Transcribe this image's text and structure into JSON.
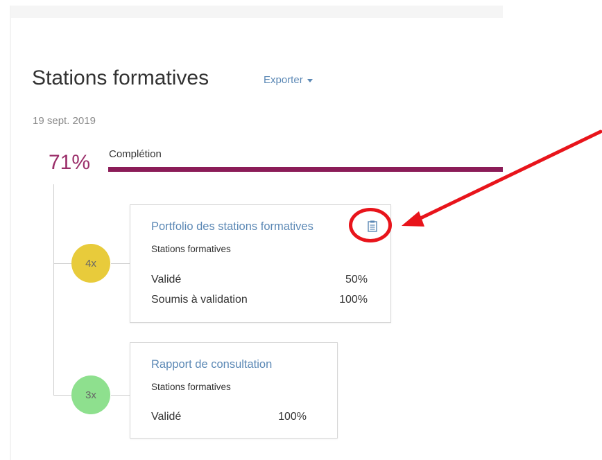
{
  "page": {
    "title": "Stations formatives",
    "export_label": "Exporter",
    "date": "19 sept. 2019"
  },
  "completion": {
    "percent_label": "71%",
    "label": "Complétion",
    "value": 0.71
  },
  "items": [
    {
      "badge": "4x",
      "badge_color": "#e8cb3b",
      "title": "Portfolio des stations formatives",
      "subtitle": "Stations formatives",
      "has_icon": true,
      "icon": "clipboard-icon",
      "rows": [
        {
          "label": "Validé",
          "value": "50%"
        },
        {
          "label": "Soumis à validation",
          "value": "100%"
        }
      ]
    },
    {
      "badge": "3x",
      "badge_color": "#8ee08e",
      "title": "Rapport de consultation",
      "subtitle": "Stations formatives",
      "has_icon": false,
      "rows": [
        {
          "label": "Validé",
          "value": "100%"
        }
      ]
    }
  ],
  "colors": {
    "accent": "#8b1c58",
    "link": "#5b88b5",
    "annotation": "#e8141b"
  }
}
